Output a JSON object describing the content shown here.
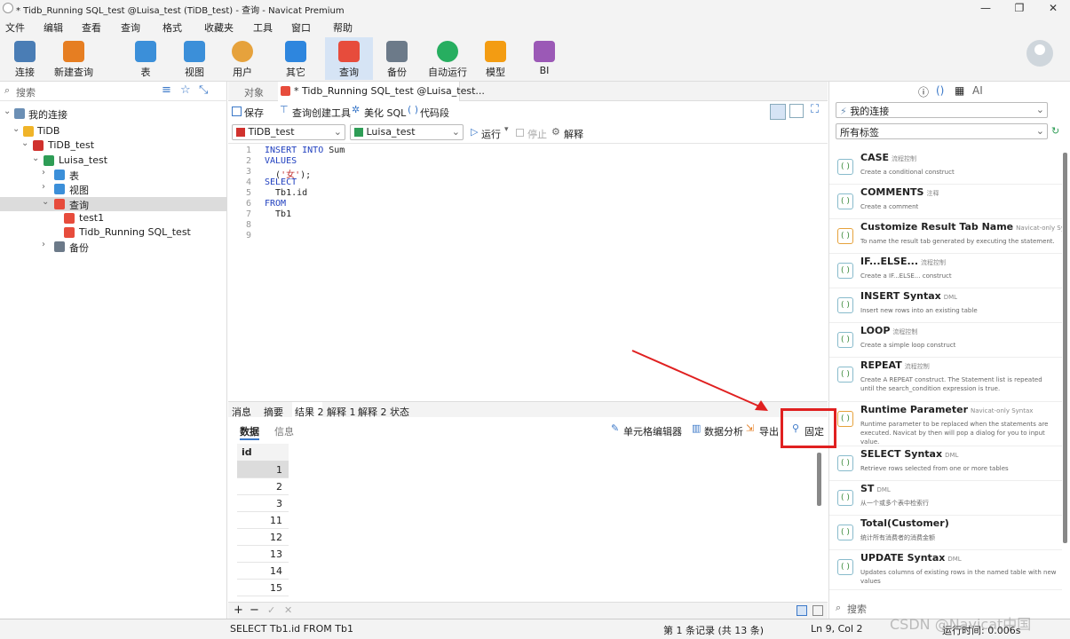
{
  "window": {
    "title": "* Tidb_Running SQL_test @Luisa_test (TiDB_test) - 查询 - Navicat Premium",
    "minimize": "—",
    "maximize": "❐",
    "close": "✕"
  },
  "menus": [
    "文件",
    "编辑",
    "查看",
    "收藏夹",
    "工具",
    "窗口",
    "帮助",
    "格式"
  ],
  "toolbar": [
    {
      "label": "连接",
      "color": "#4a7db5"
    },
    {
      "label": "新建查询",
      "color": "#e67e22"
    },
    {
      "label": "表",
      "color": "#3b8fd9"
    },
    {
      "label": "视图",
      "color": "#3b8fd9"
    },
    {
      "label": "用户",
      "color": "#e6a23c"
    },
    {
      "label": "其它",
      "color": "#2e86de"
    },
    {
      "label": "查询",
      "color": "#e74c3c"
    },
    {
      "label": "备份",
      "color": "#6c7a89"
    },
    {
      "label": "自动运行",
      "color": "#27ae60"
    },
    {
      "label": "模型",
      "color": "#f39c12"
    },
    {
      "label": "BI",
      "color": "#9b59b6"
    }
  ],
  "left": {
    "search_placeholder": "搜索",
    "tree": [
      "我的连接",
      "TiDB",
      "TiDB_test",
      "Luisa_test",
      "表",
      "视图",
      "查询",
      "test1",
      "Tidb_Running SQL_test",
      "备份"
    ]
  },
  "center": {
    "tabs": [
      "对象",
      "* Tidb_Running SQL_test @Luisa_test..."
    ],
    "qtoolbar": [
      "保存",
      "查询创建工具",
      "美化 SQL",
      "代码段"
    ],
    "connection": "TiDB_test",
    "database": "Luisa_test",
    "run": "运行",
    "stop": "停止",
    "explain": "解释",
    "code_lines": [
      "1",
      "2",
      "3",
      "4",
      "5",
      "6",
      "7",
      "8",
      "9"
    ],
    "code": {
      "l1_kw": "INSERT INTO",
      "l1_rest": " Sum",
      "l2_kw": "VALUES",
      "l3_pre": "  (",
      "l3_str": "'女'",
      "l3_post": ");",
      "l4_kw": "SELECT",
      "l5": "  Tb1.id",
      "l6_kw": "FROM",
      "l7": "  Tb1"
    },
    "result_tabs": [
      "消息",
      "摘要",
      "结果 2",
      "解释 1",
      "解释 2",
      "状态"
    ],
    "subtabs": [
      "数据",
      "信息"
    ],
    "result_buttons": [
      "单元格编辑器",
      "数据分析",
      "导出",
      "固定"
    ],
    "grid_header": "id",
    "grid_rows": [
      "1",
      "2",
      "3",
      "11",
      "12",
      "13",
      "14",
      "15"
    ]
  },
  "right": {
    "connection": "我的连接",
    "tag_filter": "所有标签",
    "search_placeholder": "搜索",
    "snippets": [
      {
        "name": "CASE",
        "tag": "流程控制",
        "desc": "Create a conditional construct"
      },
      {
        "name": "COMMENTS",
        "tag": "注释",
        "desc": "Create a comment"
      },
      {
        "name": "Customize Result Tab Name",
        "tag": "Navicat-only Syntax",
        "desc": "To name the result tab generated by executing the statement."
      },
      {
        "name": "IF...ELSE...",
        "tag": "流程控制",
        "desc": "Create a IF...ELSE... construct"
      },
      {
        "name": "INSERT Syntax",
        "tag": "DML",
        "desc": "Insert new rows into an existing table"
      },
      {
        "name": "LOOP",
        "tag": "流程控制",
        "desc": "Create a simple loop construct"
      },
      {
        "name": "REPEAT",
        "tag": "流程控制",
        "desc": "Create A REPEAT construct. The Statement list is repeated until the search_condition expression is true."
      },
      {
        "name": "Runtime Parameter",
        "tag": "Navicat-only Syntax",
        "desc": "Runtime parameter to be replaced when the statements are executed. Navicat by then will pop a dialog for you to input value."
      },
      {
        "name": "SELECT Syntax",
        "tag": "DML",
        "desc": "Retrieve rows selected from one or more tables"
      },
      {
        "name": "ST",
        "tag": "DML",
        "desc": "从一个或多个表中检索行"
      },
      {
        "name": "Total(Customer)",
        "tag": "",
        "desc": "统计所有消费者的消费金额"
      },
      {
        "name": "UPDATE Syntax",
        "tag": "DML",
        "desc": "Updates columns of existing rows in the named table with new values"
      }
    ]
  },
  "status": {
    "sql": "SELECT Tb1.id FROM Tb1",
    "records": "第 1 条记录 (共 13 条)",
    "position": "Ln 9, Col 2",
    "runtime": "运行时间: 0.006s",
    "watermark": "CSDN @Navicat中国"
  }
}
